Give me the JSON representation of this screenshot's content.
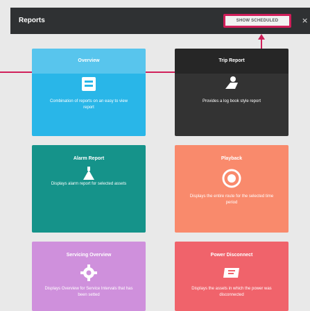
{
  "header": {
    "title": "Reports",
    "show_scheduled_label": "SHOW SCHEDULED",
    "close_label": "×"
  },
  "cards": [
    {
      "title": "Overview",
      "desc": "Combination of reports on an easy to view report",
      "icon": "list-icon",
      "color": "#29b6e8"
    },
    {
      "title": "Trip Report",
      "desc": "Provides a log book style report",
      "icon": "car-icon",
      "color": "#333333"
    },
    {
      "title": "Alarm Report",
      "desc": "Displays alarm report for selected assets",
      "icon": "alarm-icon",
      "color": "#15938a"
    },
    {
      "title": "Playback",
      "desc": "Displays the entire route for the selected time period",
      "icon": "playback-icon",
      "color": "#f98a6c"
    },
    {
      "title": "Servicing Overview",
      "desc": "Displays Overview for Service Intervals that has been setted",
      "icon": "gear-icon",
      "color": "#cf90dc"
    },
    {
      "title": "Power Disconnect",
      "desc": "Displays the assets in which the power was disconnected",
      "icon": "battery-icon",
      "color": "#f0636b"
    }
  ],
  "accent": "#d01f5a"
}
